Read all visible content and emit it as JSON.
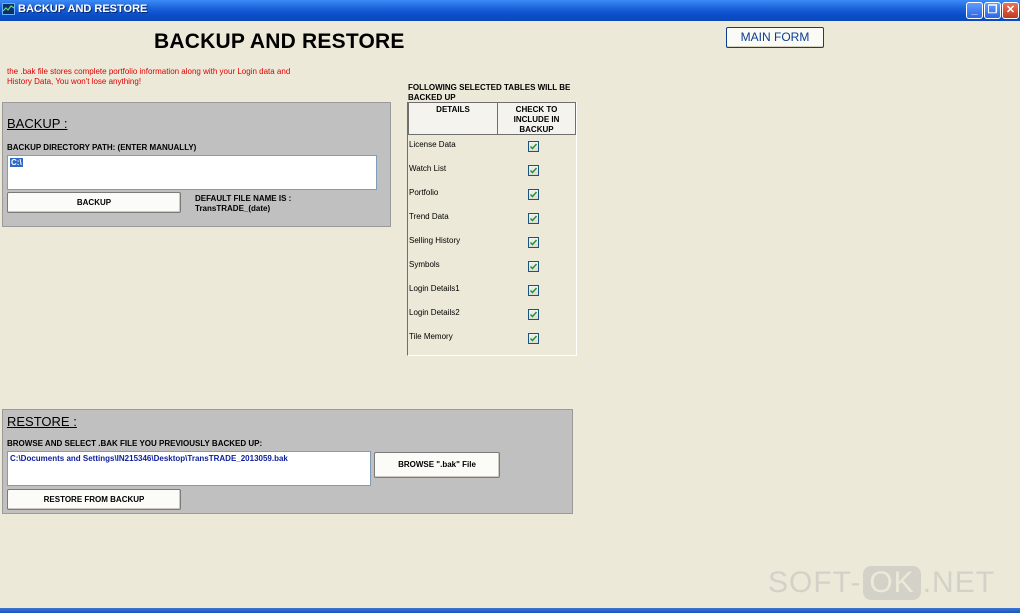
{
  "window": {
    "title": "BACKUP AND RESTORE",
    "controls": [
      "minimize-icon",
      "restore-icon",
      "close-icon"
    ]
  },
  "page": {
    "title": "BACKUP AND RESTORE",
    "main_form_button": "MAIN FORM",
    "info_note": "the .bak file stores complete portfolio information along with your Login data and History Data, You won't lose anything!"
  },
  "backup": {
    "heading": "BACKUP :",
    "path_label": "BACKUP DIRECTORY PATH: (ENTER MANUALLY)",
    "path_value": "C:\\",
    "button": "BACKUP",
    "default_name_label": "DEFAULT FILE NAME IS :",
    "default_name_value": "TransTRADE_(date)"
  },
  "tables": {
    "heading": "FOLLOWING SELECTED TABLES WILL BE BACKED UP",
    "col_details": "DETAILS",
    "col_check": "CHECK TO INCLUDE IN BACKUP",
    "rows": [
      {
        "label": "License Data",
        "checked": true
      },
      {
        "label": "Watch List",
        "checked": true
      },
      {
        "label": "Portfolio",
        "checked": true
      },
      {
        "label": "Trend Data",
        "checked": true
      },
      {
        "label": "Selling History",
        "checked": true
      },
      {
        "label": "Symbols",
        "checked": true
      },
      {
        "label": "Login Details1",
        "checked": true
      },
      {
        "label": "Login Details2",
        "checked": true
      },
      {
        "label": "Tile Memory",
        "checked": true
      }
    ]
  },
  "restore": {
    "heading": "RESTORE :",
    "browse_label": "BROWSE AND SELECT .BAK FILE YOU PREVIOUSLY BACKED UP:",
    "path_value": "C:\\Documents and Settings\\IN215346\\Desktop\\TransTRADE_2013059.bak",
    "browse_button": "BROWSE  \".bak\" File",
    "restore_button": "RESTORE FROM BACKUP"
  },
  "watermark": {
    "part1": "SOFT-",
    "part2": "OK",
    "part3": ".NET"
  },
  "colors": {
    "titlebar": "#0a4ec9",
    "form_background": "#ece9d8",
    "panel": "#c0c0c0",
    "note_text": "#e00000",
    "restore_path_text": "#0b1f9e"
  }
}
